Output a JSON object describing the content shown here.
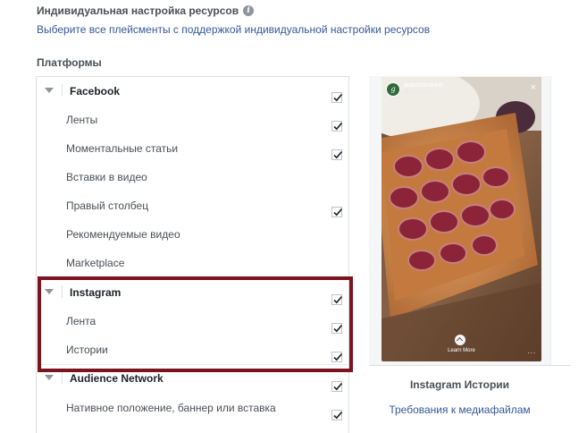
{
  "header": {
    "title": "Индивидуальная настройка ресурсов",
    "info_icon": "i",
    "select_link": "Выберите все плейсменты с поддержкой индивидуальной настройки ресурсов"
  },
  "platforms": {
    "label": "Платформы",
    "facebook": {
      "name": "Facebook",
      "checked": true,
      "items": [
        {
          "label": "Ленты",
          "checked": true
        },
        {
          "label": "Моментальные статьи",
          "checked": true
        },
        {
          "label": "Вставки в видео",
          "checked": false
        },
        {
          "label": "Правый столбец",
          "checked": true
        },
        {
          "label": "Рекомендуемые видео",
          "checked": false
        },
        {
          "label": "Marketplace",
          "checked": false
        }
      ]
    },
    "instagram": {
      "name": "Instagram",
      "checked": true,
      "items": [
        {
          "label": "Лента",
          "checked": true
        },
        {
          "label": "Истории",
          "checked": true
        }
      ]
    },
    "audience_network": {
      "name": "Audience Network",
      "checked": true,
      "items": [
        {
          "label": "Нативное положение, баннер или вставка",
          "checked": true
        }
      ]
    }
  },
  "preview": {
    "account_name": "jaspersmarket",
    "sponsored": "Sponsored",
    "avatar_letter": "g",
    "close": "×",
    "cta": "Learn More",
    "more": "...",
    "caption": "Instagram Истории",
    "media_link": "Требования к медиафайлам"
  },
  "colors": {
    "link": "#365899",
    "highlight": "#7b1320",
    "text": "#4b4f56"
  }
}
